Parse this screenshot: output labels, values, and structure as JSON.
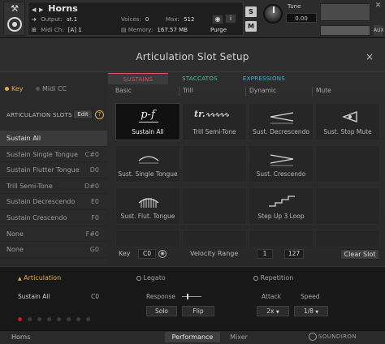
{
  "header": {
    "instrument_name": "Horns",
    "output_label": "Output:",
    "output_value": "st.1",
    "voices_label": "Voices:",
    "voices_value": "0",
    "max_label": "Max:",
    "max_value": "512",
    "purge_label": "Purge",
    "midi_label": "Midi Ch:",
    "midi_value": "[A] 1",
    "memory_label": "Memory:",
    "memory_value": "167.57 MB",
    "solo_btn": "S",
    "mute_btn": "M",
    "tune_label": "Tune",
    "tune_value": "0.00",
    "aux_label": "AUX",
    "close_icon": "close-icon"
  },
  "panel": {
    "title": "Articulation Slot Setup",
    "close": "×"
  },
  "trigger": {
    "key_label": "Key",
    "midicc_label": "Midi CC",
    "selected": "Key"
  },
  "slots": {
    "header": "ARTICULATION SLOTS",
    "edit_label": "Edit",
    "help": "?",
    "items": [
      {
        "name": "Sustain All",
        "key": "",
        "selected": true
      },
      {
        "name": "Sustain Single Tongue",
        "key": "C#0"
      },
      {
        "name": "Sustain Flutter Tongue",
        "key": "D0"
      },
      {
        "name": "Trill Semi-Tone",
        "key": "D#0"
      },
      {
        "name": "Sustain Decrescendo",
        "key": "E0"
      },
      {
        "name": "Sustain Crescendo",
        "key": "F0"
      },
      {
        "name": "None",
        "key": "F#0"
      },
      {
        "name": "None",
        "key": "G0"
      }
    ]
  },
  "tabs": {
    "sustains": "SUSTAINS",
    "staccatos": "STACCATOS",
    "expressions": "EXPRESSIONS"
  },
  "columns": [
    "Basic",
    "Trill",
    "Dynamic",
    "Mute"
  ],
  "cells": {
    "sustain_all": "Sustain All",
    "trill_semi": "Trill Semi-Tone",
    "sust_decresc": "Sust. Decrescendo",
    "sust_stop_mute": "Sust. Stop Mute",
    "sust_single": "Sust. Single Tongue",
    "sust_cresc": "Sust. Crescendo",
    "sust_flut": "Sust. Flut. Tongue",
    "step_up": "Step Up 3 Loop",
    "pf_glyph": "p-f",
    "tr_glyph": "tr."
  },
  "controls": {
    "key_label": "Key",
    "key_value": "C0",
    "velocity_label": "Velocity Range",
    "vel_low": "1",
    "vel_high": "127",
    "clear_slot": "Clear Slot"
  },
  "articulation": {
    "header": "Articulation",
    "name": "Sustain All",
    "key": "C0",
    "dots_total": 8,
    "dots_on": 1
  },
  "legato": {
    "header": "Legato",
    "response_label": "Response",
    "solo_label": "Solo",
    "flip_label": "Flip"
  },
  "repetition": {
    "header": "Repetition",
    "attack_label": "Attack",
    "speed_label": "Speed",
    "attack_value": "2x",
    "speed_value": "1/8"
  },
  "footer": {
    "name": "Horns",
    "performance": "Performance",
    "mixer": "Mixer",
    "brand": "SOUNDIRON"
  },
  "colors": {
    "accent_gold": "#e0b04c",
    "tab_red": "#e05060",
    "tab_green": "#58c08a",
    "tab_blue": "#4ab0e0",
    "dot_red": "#c01c2c"
  }
}
